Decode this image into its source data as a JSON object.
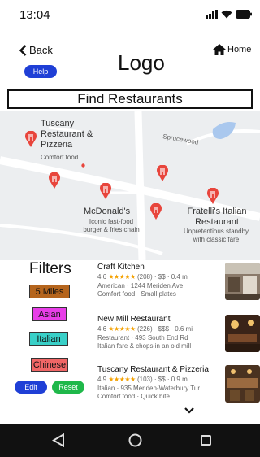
{
  "status_bar": {
    "time": "13:04"
  },
  "header": {
    "back_label": "Back",
    "help_label": "Help",
    "logo_text": "Logo",
    "home_label": "Home"
  },
  "find_bar": {
    "label": "Find Restaurants"
  },
  "map": {
    "street_label": "Sprucewood",
    "places": [
      {
        "name_lines": [
          "Tuscany",
          "Restaurant &",
          "Pizzeria"
        ],
        "subtitle": "Comfort food"
      },
      {
        "name": "McDonald's",
        "subtitle_lines": [
          "Iconic fast-food",
          "burger & fries chain"
        ]
      },
      {
        "name_lines": [
          "Fratelli's Italian",
          "Restaurant"
        ],
        "subtitle_lines": [
          "Unpretentious standby",
          "with classic fare"
        ]
      }
    ]
  },
  "filters": {
    "title": "Filters",
    "chips": [
      "5 Miles",
      "Asian",
      "Italian",
      "Chinese"
    ],
    "edit_label": "Edit",
    "reset_label": "Reset"
  },
  "results": [
    {
      "name": "Craft Kitchen",
      "rating": "4.6",
      "stars": "★★★★★",
      "meta": "(208) · $$ · 0.4 mi",
      "line1": "American · 1244 Meriden Ave",
      "line2": "Comfort food · Small plates"
    },
    {
      "name": "New Mill Restaurant",
      "rating": "4.6",
      "stars": "★★★★★",
      "meta": "(226) · $$$ · 0.6 mi",
      "line1": "Restaurant · 493 South End Rd",
      "line2": "Italian fare & chops in an old mill"
    },
    {
      "name": "Tuscany Restaurant & Pizzeria",
      "rating": "4.9",
      "stars": "★★★★★",
      "meta": "(103) · $$ · 0.9 mi",
      "line1": "Italian · 935 Meriden-Waterbury Tur...",
      "line2": "Comfort food · Quick bite"
    }
  ],
  "colors": {
    "help_button": "#1f3fd6",
    "edit_button": "#1f3fd6",
    "reset_button": "#1fb84a",
    "chip_miles": "#b5651d",
    "chip_asian": "#e83ee8",
    "chip_italian": "#39d0c8",
    "chip_chinese": "#f06666",
    "map_pin": "#e8453c",
    "star": "#f4a100"
  }
}
